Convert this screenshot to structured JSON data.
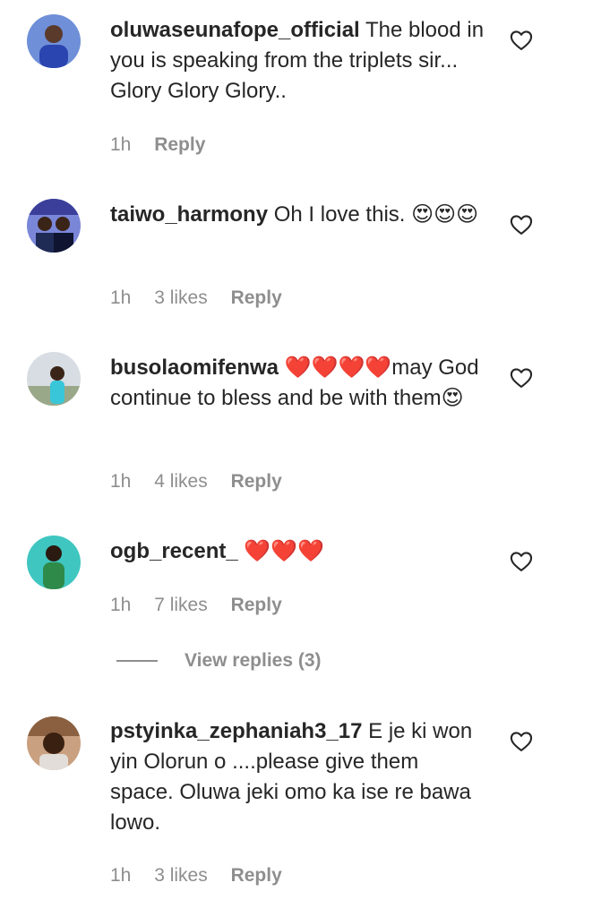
{
  "comments": [
    {
      "username": "oluwaseunafope_official",
      "text": "The blood in you is speaking from the triplets sir... Glory Glory Glory..",
      "time": "1h",
      "likes": "",
      "reply_label": "Reply"
    },
    {
      "username": "taiwo_harmony",
      "text": "Oh I love this. 😍😍😍",
      "time": "1h",
      "likes": "3 likes",
      "reply_label": "Reply"
    },
    {
      "username": "busolaomifenwa",
      "text": "❤️❤️❤️❤️may God continue to bless and be with them😍",
      "time": "1h",
      "likes": "4 likes",
      "reply_label": "Reply"
    },
    {
      "username": "ogb_recent_",
      "text": "❤️❤️❤️",
      "time": "1h",
      "likes": "7 likes",
      "reply_label": "Reply"
    },
    {
      "username": "pstyinka_zephaniah3_17",
      "text": "E je ki won yin Olorun o ....please give them space. Oluwa jeki omo ka ise re bawa lowo.",
      "time": "1h",
      "likes": "3 likes",
      "reply_label": "Reply"
    }
  ],
  "view_replies": {
    "label": "View replies (3)"
  },
  "colors": {
    "text": "#262626",
    "muted": "#8e8e8e",
    "background": "#ffffff"
  },
  "icons": {
    "like": "heart-outline-icon",
    "avatar": "profile-photo"
  }
}
